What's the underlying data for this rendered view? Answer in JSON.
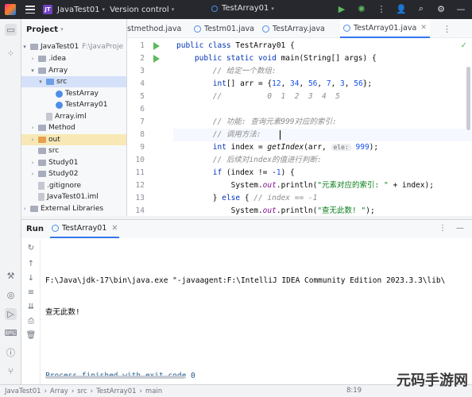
{
  "titlebar": {
    "project_badge": "JT",
    "project_name": "JavaTest01",
    "version_control": "Version control",
    "run_config": "TestArray01"
  },
  "project_panel": {
    "title": "Project",
    "items": [
      {
        "label": "JavaTest01",
        "extra": "F:\\JavaProje"
      },
      {
        "label": ".idea"
      },
      {
        "label": "Array"
      },
      {
        "label": "src"
      },
      {
        "label": "TestArray"
      },
      {
        "label": "TestArray01"
      },
      {
        "label": "Array.iml"
      },
      {
        "label": "Method"
      },
      {
        "label": "out"
      },
      {
        "label": "src"
      },
      {
        "label": "Study01"
      },
      {
        "label": "Study02"
      },
      {
        "label": ".gitignore"
      },
      {
        "label": "JavaTest01.iml"
      },
      {
        "label": "External Libraries"
      }
    ]
  },
  "editor": {
    "tabs": [
      {
        "label": "stmethod.java"
      },
      {
        "label": "Testm01.java"
      },
      {
        "label": "TestArray.java"
      },
      {
        "label": "TestArray01.java"
      }
    ],
    "line_numbers": [
      "1",
      "2",
      "3",
      "4",
      "5",
      "6",
      "7",
      "8",
      "9",
      "10",
      "11",
      "12",
      "13",
      "14"
    ],
    "lines": {
      "l1_a": "public class ",
      "l1_b": "TestArray01 {",
      "l2_a": "    public static void ",
      "l2_b": "main",
      "l2_c": "(String[] args) {",
      "l3": "        // 给定一个数组:",
      "l4_a": "        int",
      "l4_b": "[] arr = {",
      "l4_c": "12",
      "l4_d": ", ",
      "l4_e": "34",
      "l4_f": ", ",
      "l4_g": "56",
      "l4_h": ", ",
      "l4_i": "7",
      "l4_j": ", ",
      "l4_k": "3",
      "l4_l": ", ",
      "l4_m": "56",
      "l4_n": "};",
      "l5": "        //          0  1  2  3  4  5",
      "l7": "        // 功能: 查询元素999对应的索引:",
      "l8": "        // 调用方法:",
      "l9_a": "        int",
      "l9_b": " index = ",
      "l9_c": "getIndex",
      "l9_d": "(arr, ",
      "l9_hint": "ele:",
      "l9_e": "999",
      "l9_f": ");",
      "l10": "        // 后续对index的值进行判断:",
      "l11_a": "        if",
      "l11_b": " (index != -",
      "l11_c": "1",
      "l11_d": ") {",
      "l12_a": "            System.",
      "l12_b": "out",
      "l12_c": ".println(",
      "l12_d": "\"元素对应的索引: \"",
      "l12_e": " + index);",
      "l13_a": "        } ",
      "l13_b": "else",
      "l13_c": " { ",
      "l13_d": "// index == -1",
      "l14_a": "            System.",
      "l14_b": "out",
      "l14_c": ".println(",
      "l14_d": "\"查无此数! \"",
      "l14_e": ");"
    }
  },
  "run_panel": {
    "title": "Run",
    "tab": "TestArray01",
    "console": [
      "F:\\Java\\jdk-17\\bin\\java.exe \"-javaagent:F:\\IntelliJ IDEA Community Edition 2023.3.3\\lib\\",
      "查无此数!",
      "",
      "Process finished with exit code 0"
    ]
  },
  "statusbar": {
    "crumbs": [
      "JavaTest01",
      "Array",
      "src",
      "TestArray01",
      "main"
    ],
    "position": "8:19"
  },
  "watermark": "元码手游网"
}
